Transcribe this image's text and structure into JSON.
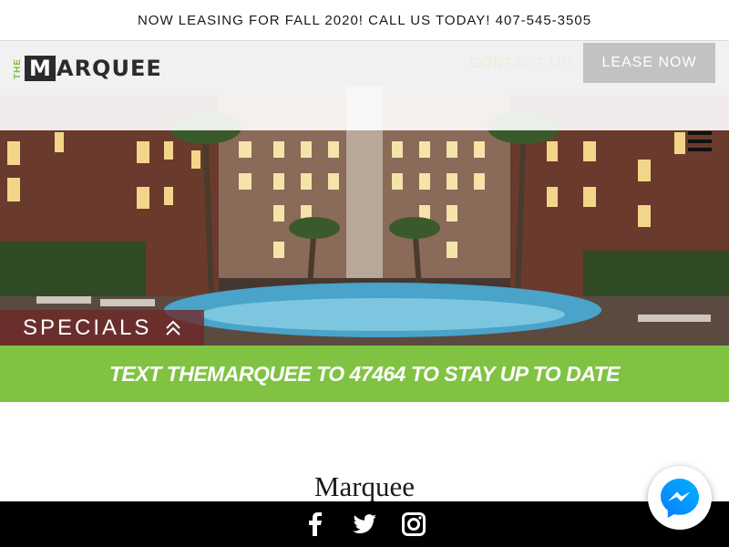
{
  "announcement": "NOW LEASING FOR FALL 2020! CALL US TODAY! 407-545-3505",
  "logo": {
    "the": "THE",
    "m": "M",
    "rest": "ARQUEE"
  },
  "nav": {
    "contact_label": "CONTACT US",
    "lease_label": "LEASE NOW"
  },
  "specials": {
    "label": "SPECIALS"
  },
  "banner": {
    "text": "TEXT THEMARQUEE TO 47464 TO STAY UP TO DATE"
  },
  "section": {
    "title": "Marquee"
  },
  "colors": {
    "accent_green": "#80c342",
    "specials_red": "#6e2828",
    "lease_gray": "#c2c2c2"
  },
  "icons": [
    "facebook-icon",
    "twitter-icon",
    "instagram-icon",
    "messenger-icon",
    "hamburger-icon",
    "double-chevron-up-icon"
  ]
}
